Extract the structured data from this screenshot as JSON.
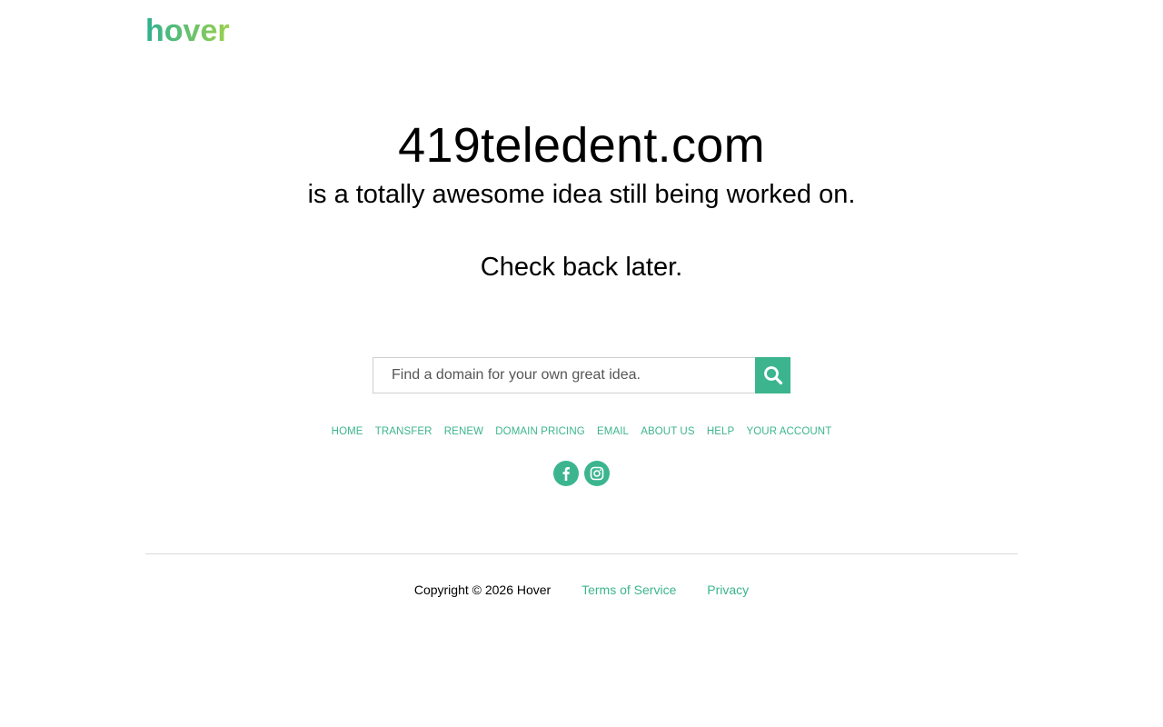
{
  "brand": {
    "logo_text": "hover",
    "accent_color": "#3cb58f"
  },
  "hero": {
    "domain": "419teledent.com",
    "tagline": "is a totally awesome idea still being worked on.",
    "check_back": "Check back later."
  },
  "search": {
    "placeholder": "Find a domain for your own great idea.",
    "value": "",
    "button_icon": "search-icon"
  },
  "nav": {
    "items": [
      {
        "label": "HOME"
      },
      {
        "label": "TRANSFER"
      },
      {
        "label": "RENEW"
      },
      {
        "label": "DOMAIN PRICING"
      },
      {
        "label": "EMAIL"
      },
      {
        "label": "ABOUT US"
      },
      {
        "label": "HELP"
      },
      {
        "label": "YOUR ACCOUNT"
      }
    ]
  },
  "social": {
    "icons": [
      "facebook-icon",
      "instagram-icon"
    ]
  },
  "footer": {
    "copyright": "Copyright © 2026 Hover",
    "terms": "Terms of Service",
    "privacy": "Privacy"
  }
}
